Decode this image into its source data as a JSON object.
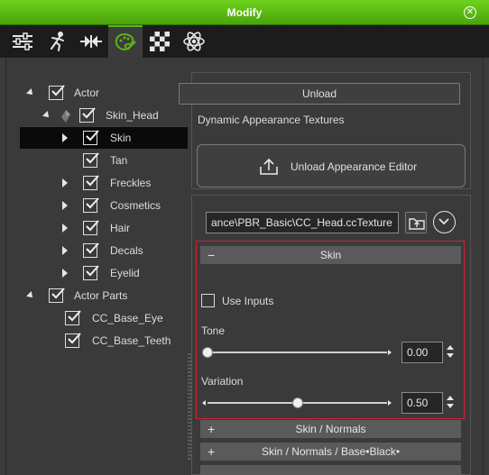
{
  "window": {
    "title": "Modify"
  },
  "tabs": [
    {
      "icon": "sliders-icon"
    },
    {
      "icon": "motion-icon"
    },
    {
      "icon": "align-icon"
    },
    {
      "icon": "appearance-palette-icon",
      "active": true
    },
    {
      "icon": "checkerboard-texture-icon"
    },
    {
      "icon": "atom-physics-icon"
    }
  ],
  "tree": {
    "items": [
      {
        "label": "Actor",
        "checked": true,
        "expand": "down"
      },
      {
        "label": "Skin_Head",
        "checked": true,
        "expand": "down"
      },
      {
        "label": "Skin",
        "checked": true,
        "expand": "right",
        "selected": true
      },
      {
        "label": "Tan",
        "checked": true
      },
      {
        "label": "Freckles",
        "checked": true,
        "expand": "right"
      },
      {
        "label": "Cosmetics",
        "checked": true,
        "expand": "right"
      },
      {
        "label": "Hair",
        "checked": true,
        "expand": "right"
      },
      {
        "label": "Decals",
        "checked": true,
        "expand": "right"
      },
      {
        "label": "Eyelid",
        "checked": true,
        "expand": "right"
      },
      {
        "label": "Actor Parts",
        "checked": true,
        "expand": "down"
      },
      {
        "label": "CC_Base_Eye",
        "checked": true
      },
      {
        "label": "CC_Base_Teeth",
        "checked": true
      }
    ]
  },
  "right": {
    "unload_label": "Unload",
    "dynamic_textures_label": "Dynamic Appearance Textures",
    "unload_editor_label": "Unload Appearance Editor",
    "texture_path": "ance\\PBR_Basic\\CC_Head.ccTexture"
  },
  "skin": {
    "header": "Skin",
    "use_inputs_label": "Use Inputs",
    "use_inputs_checked": false,
    "tone_label": "Tone",
    "tone_value": "0.00",
    "tone_level": 0.0,
    "variation_label": "Variation",
    "variation_value": "0.50",
    "variation_level": 0.5
  },
  "collapsed_sections": [
    {
      "label": "Skin / Normals"
    },
    {
      "label": "Skin / Normals / Base•Black•"
    }
  ],
  "colors": {
    "accent": "#59b516",
    "highlight_border": "#d0232f"
  }
}
